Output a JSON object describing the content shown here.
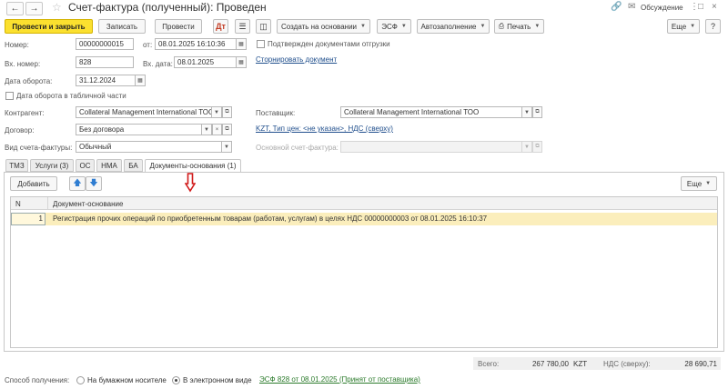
{
  "window": {
    "title": "Счет-фактура (полученный): Проведен",
    "discuss_label": "Обсуждение"
  },
  "toolbar": {
    "post_close": "Провести и закрыть",
    "save": "Записать",
    "post": "Провести",
    "create_based": "Создать на основании",
    "esf": "ЭСФ",
    "autofill": "Автозаполнение",
    "print": "Печать",
    "more": "Еще"
  },
  "form": {
    "number_label": "Номер:",
    "number_value": "00000000015",
    "from_label": "от:",
    "from_value": "08.01.2025 16:10:36",
    "confirmed_label": "Подтвержден документами отгрузки",
    "in_number_label": "Вх. номер:",
    "in_number_value": "828",
    "in_date_label": "Вх. дата:",
    "in_date_value": "08.01.2025",
    "storno_link": "Сторнировать документ",
    "turnover_label": "Дата оборота:",
    "turnover_value": "31.12.2024",
    "turnover_in_table": "Дата оборота в табличной части",
    "counterparty_label": "Контрагент:",
    "counterparty_value": "Collateral Management International ТОО",
    "supplier_label": "Поставщик:",
    "supplier_value": "Collateral Management International ТОО",
    "contract_label": "Договор:",
    "contract_value": "Без договора",
    "price_link": "KZT, Тип цен: <не указан>, НДС (сверху)",
    "invoice_type_label": "Вид счета-фактуры:",
    "invoice_type_value": "Обычный",
    "main_invoice_label": "Основной счет-фактура:"
  },
  "tabs": [
    {
      "label": "ТМЗ"
    },
    {
      "label": "Услуги (3)"
    },
    {
      "label": "ОС"
    },
    {
      "label": "НМА"
    },
    {
      "label": "БА"
    },
    {
      "label": "Документы-основания (1)"
    }
  ],
  "table_toolbar": {
    "add": "Добавить",
    "more": "Еще"
  },
  "table": {
    "columns": [
      "N",
      "Документ-основание"
    ],
    "rows": [
      {
        "n": "1",
        "doc": "Регистрация прочих операций по приобретенным товарам (работам, услугам) в целях НДС 00000000003 от 08.01.2025 16:10:37"
      }
    ]
  },
  "totals": {
    "total_label": "Всего:",
    "total_value": "267 780,00",
    "currency": "KZT",
    "vat_label": "НДС (сверху):",
    "vat_value": "28 690,71"
  },
  "footer": {
    "method_label": "Способ получения:",
    "paper_label": "На бумажном носителе",
    "electronic_label": "В электронном виде",
    "esf_link": "ЭСФ 828 от 08.01.2025 (Принят от поставщика)"
  },
  "colors": {
    "primary_button": "#fbe02f",
    "selected_row": "#fbeebc",
    "link": "#1f4e8c",
    "link_green": "#2a7a2a",
    "arrow": "#d11a1a"
  }
}
